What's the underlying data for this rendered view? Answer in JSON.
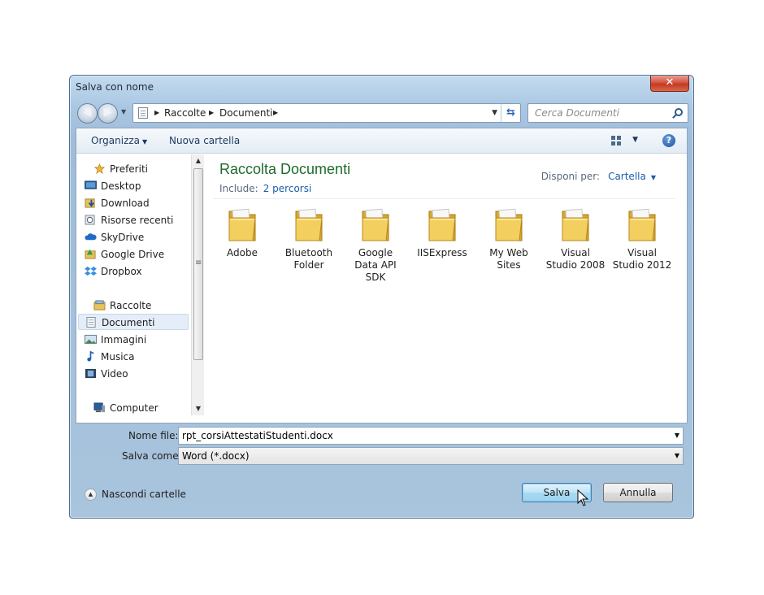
{
  "window": {
    "title": "Salva con nome",
    "close_glyph": "✕"
  },
  "nav": {
    "back_glyph": "◀",
    "forward_glyph": "▶",
    "breadcrumb": [
      "Raccolte",
      "Documenti"
    ],
    "search_placeholder": "Cerca Documenti"
  },
  "toolbar": {
    "organize": "Organizza",
    "new_folder": "Nuova cartella",
    "help_glyph": "?"
  },
  "sidebar": {
    "favorites": {
      "label": "Preferiti",
      "items": [
        "Desktop",
        "Download",
        "Risorse recenti",
        "SkyDrive",
        "Google Drive",
        "Dropbox"
      ]
    },
    "libraries": {
      "label": "Raccolte",
      "items": [
        "Documenti",
        "Immagini",
        "Musica",
        "Video"
      ],
      "selected": "Documenti"
    },
    "computer": {
      "label": "Computer"
    }
  },
  "main": {
    "library_title": "Raccolta Documenti",
    "include_label": "Include:",
    "include_link": "2 percorsi",
    "arrange_label": "Disponi per:",
    "arrange_value": "Cartella",
    "folders": [
      {
        "lines": [
          "Adobe"
        ]
      },
      {
        "lines": [
          "Bluetooth",
          "Folder"
        ]
      },
      {
        "lines": [
          "Google",
          "Data API",
          "SDK"
        ]
      },
      {
        "lines": [
          "IISExpress"
        ]
      },
      {
        "lines": [
          "My Web",
          "Sites"
        ]
      },
      {
        "lines": [
          "Visual",
          "Studio 2008"
        ]
      },
      {
        "lines": [
          "Visual",
          "Studio 2012"
        ]
      }
    ]
  },
  "form": {
    "filename_label": "Nome file:",
    "filename_value": "rpt_corsiAttestatiStudenti.docx",
    "saveas_label": "Salva come:",
    "saveas_value": "Word (*.docx)"
  },
  "footer": {
    "hide_folders": "Nascondi cartelle",
    "save_button": "Salva",
    "cancel_button": "Annulla"
  },
  "colors": {
    "library_title": "#1e6b2c",
    "link": "#1a5ea8",
    "save_button": "#a6d9f4",
    "close_button": "#c23a22"
  }
}
